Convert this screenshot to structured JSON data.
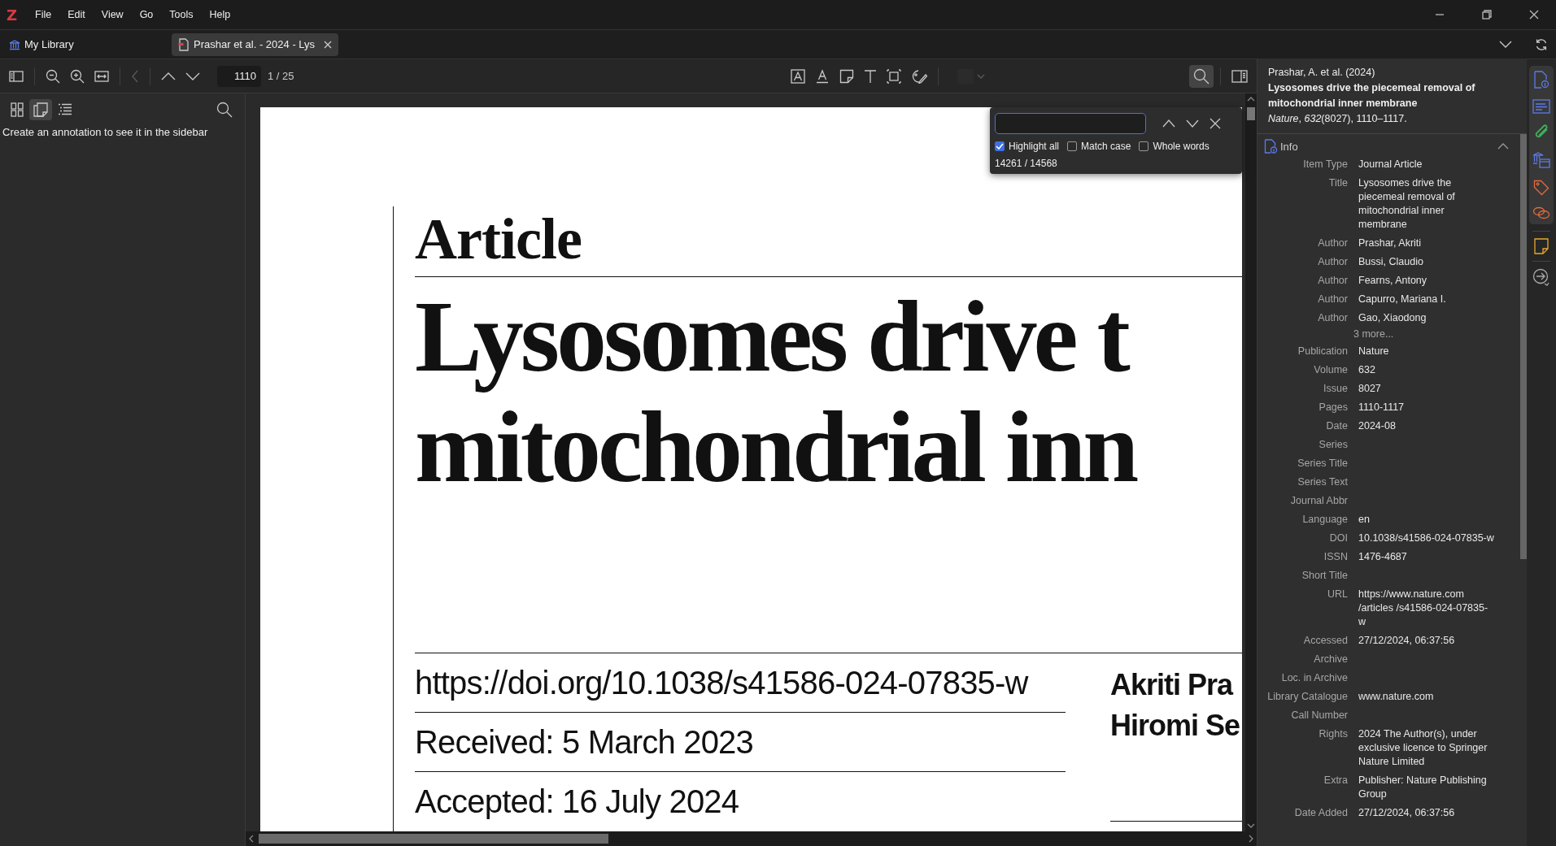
{
  "logo": "Z",
  "menu": [
    "File",
    "Edit",
    "View",
    "Go",
    "Tools",
    "Help"
  ],
  "tabs": [
    {
      "label": "My Library",
      "kind": "library",
      "selected": false
    },
    {
      "label": "Prashar et al. - 2024 - Lys",
      "kind": "pdf",
      "selected": true
    }
  ],
  "toolbar": {
    "page_input": "1110",
    "page_count": "1 / 25"
  },
  "sidebar": {
    "views": [
      {
        "kind": "thumbnails",
        "selected": false
      },
      {
        "kind": "annotations",
        "selected": true
      },
      {
        "kind": "outline",
        "selected": false
      }
    ],
    "message": "Create an annotation to see it in the sidebar"
  },
  "find": {
    "options": [
      {
        "label": "Highlight all",
        "checked": true
      },
      {
        "label": "Match case",
        "checked": false
      },
      {
        "label": "Whole words",
        "checked": false
      }
    ],
    "result": "14261 / 14568"
  },
  "document": {
    "heading": "Article",
    "title_lines": [
      "Lysosomes drive t",
      "mitochondrial inn"
    ],
    "meta": [
      "https://doi.org/10.1038/s41586-024-07835-w",
      "Received: 5 March 2023",
      "Accepted: 16 July 2024"
    ],
    "authors": [
      "Akriti Pra",
      "Hiromi Se"
    ]
  },
  "item_pane": {
    "citation": {
      "authors": "Prashar, A. et al. (2024)",
      "title": "Lysosomes drive the piecemeal removal of mitochondrial inner membrane",
      "source": "*Nature*, *632*(8027), 1110–1117."
    },
    "section": {
      "title": "Info",
      "expanded": true
    },
    "fields": [
      {
        "kind": "field",
        "label": "Item Type",
        "value": "Journal Article"
      },
      {
        "kind": "field",
        "label": "Title",
        "value": "Lysosomes drive the piecemeal removal of mitochondrial inner membrane"
      },
      {
        "kind": "field",
        "label": "Author",
        "value": "Prashar, Akriti"
      },
      {
        "kind": "field",
        "label": "Author",
        "value": "Bussi, Claudio"
      },
      {
        "kind": "field",
        "label": "Author",
        "value": "Fearns, Antony"
      },
      {
        "kind": "field",
        "label": "Author",
        "value": "Capurro, Mariana I."
      },
      {
        "kind": "field",
        "label": "Author",
        "value": "Gao, Xiaodong"
      },
      {
        "kind": "more",
        "value": "3 more..."
      },
      {
        "kind": "field",
        "label": "Publication",
        "value": "Nature"
      },
      {
        "kind": "field",
        "label": "Volume",
        "value": "632"
      },
      {
        "kind": "field",
        "label": "Issue",
        "value": "8027"
      },
      {
        "kind": "field",
        "label": "Pages",
        "value": "1110-1117"
      },
      {
        "kind": "field",
        "label": "Date",
        "value": "2024-08"
      },
      {
        "kind": "field",
        "label": "Series"
      },
      {
        "kind": "field",
        "label": "Series Title"
      },
      {
        "kind": "field",
        "label": "Series Text"
      },
      {
        "kind": "field",
        "label": "Journal Abbr"
      },
      {
        "kind": "field",
        "label": "Language",
        "value": "en"
      },
      {
        "kind": "field",
        "label": "DOI",
        "value": "10.1038/s41586-024-07835-w"
      },
      {
        "kind": "field",
        "label": "ISSN",
        "value": "1476-4687"
      },
      {
        "kind": "field",
        "label": "Short Title"
      },
      {
        "kind": "field",
        "label": "URL",
        "value": "https://www.nature.com /articles /s41586-024-07835-w"
      },
      {
        "kind": "field",
        "label": "Accessed",
        "value": "27/12/2024, 06:37:56"
      },
      {
        "kind": "field",
        "label": "Archive"
      },
      {
        "kind": "field",
        "label": "Loc. in Archive"
      },
      {
        "kind": "field",
        "label": "Library Catalogue",
        "value": "www.nature.com"
      },
      {
        "kind": "field",
        "label": "Call Number"
      },
      {
        "kind": "field",
        "label": "Rights",
        "value": "2024 The Author(s), under exclusive licence to Springer Nature Limited"
      },
      {
        "kind": "field",
        "label": "Extra",
        "value": "Publisher: Nature Publishing Group"
      },
      {
        "kind": "field",
        "label": "Date Added",
        "value": "27/12/2024, 06:37:56"
      }
    ]
  }
}
